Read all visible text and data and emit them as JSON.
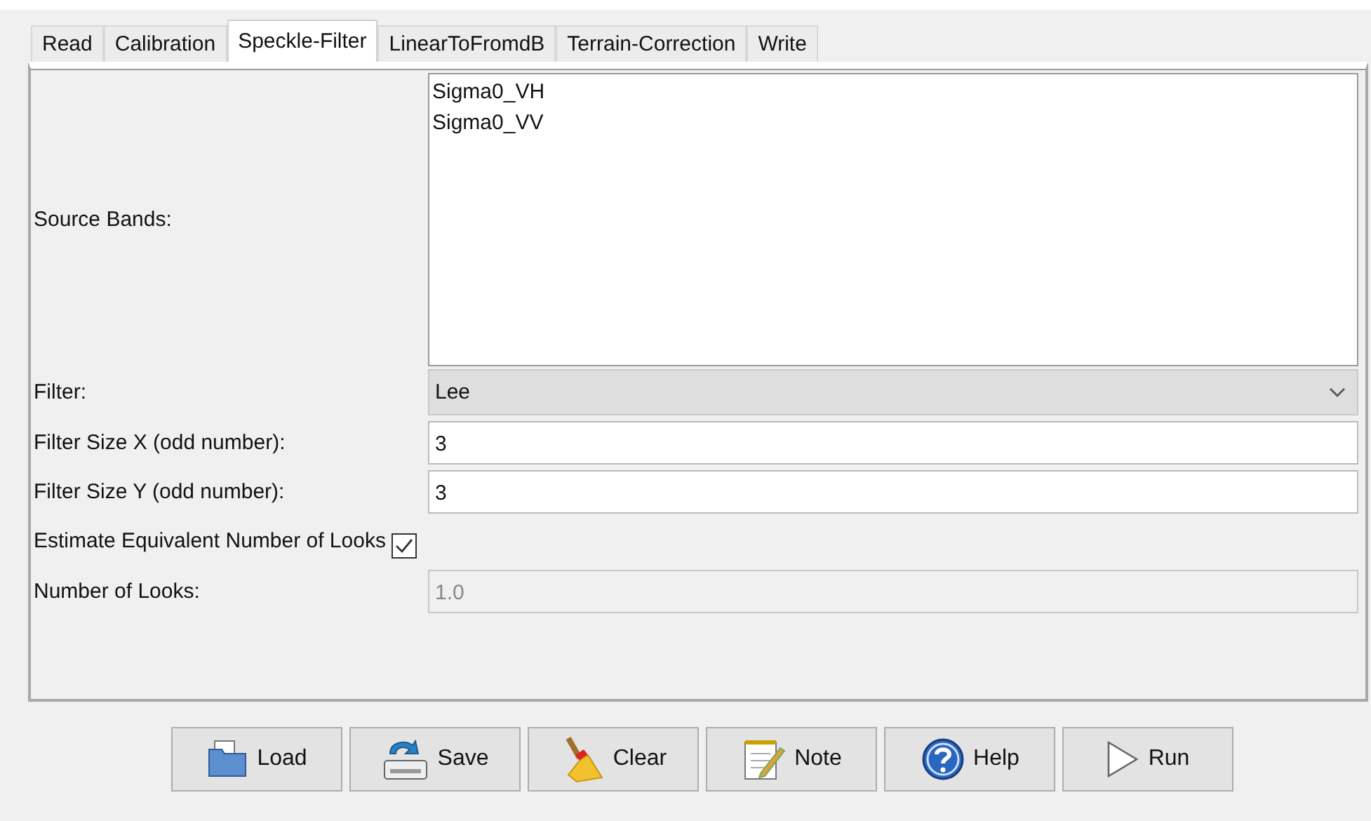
{
  "tabs": [
    {
      "label": "Read",
      "selected": false
    },
    {
      "label": "Calibration",
      "selected": false
    },
    {
      "label": "Speckle-Filter",
      "selected": true
    },
    {
      "label": "LinearToFromdB",
      "selected": false
    },
    {
      "label": "Terrain-Correction",
      "selected": false
    },
    {
      "label": "Write",
      "selected": false
    }
  ],
  "fields": [
    {
      "kind": "list",
      "label": "Source Bands:",
      "items": [
        "Sigma0_VH",
        "Sigma0_VV"
      ]
    },
    {
      "kind": "dropdown",
      "label": "Filter:",
      "value": "Lee"
    },
    {
      "kind": "text",
      "label": "Filter Size X (odd number):",
      "value": "3",
      "disabled": false
    },
    {
      "kind": "text",
      "label": "Filter Size Y (odd number):",
      "value": "3",
      "disabled": false
    },
    {
      "kind": "checkbox",
      "label": "Estimate Equivalent Number of Looks",
      "checked": true
    },
    {
      "kind": "text",
      "label": "Number of Looks:",
      "value": "1.0",
      "disabled": true
    }
  ],
  "buttons": [
    {
      "label": "Load",
      "kind": "load"
    },
    {
      "label": "Save",
      "kind": "save"
    },
    {
      "label": "Clear",
      "kind": "clear"
    },
    {
      "label": "Note",
      "kind": "note"
    },
    {
      "label": "Help",
      "kind": "help"
    },
    {
      "label": "Run",
      "kind": "run"
    }
  ]
}
